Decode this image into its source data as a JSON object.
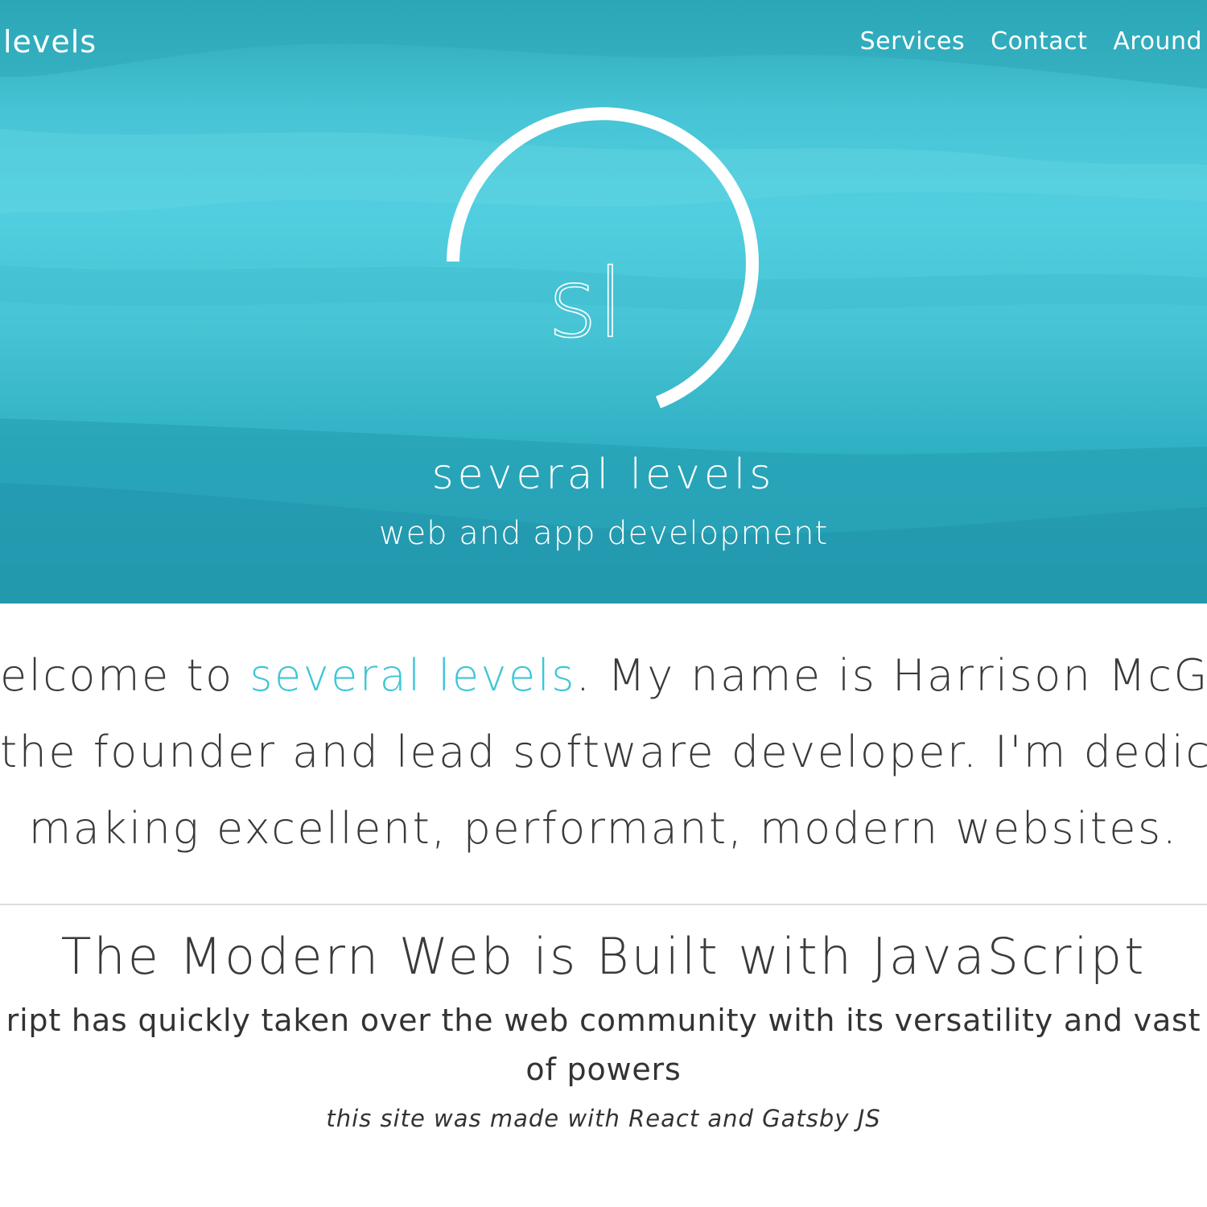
{
  "header": {
    "brand": "levels",
    "nav": [
      "Services",
      "Contact",
      "Around"
    ]
  },
  "hero": {
    "logo_text": "sl",
    "title": "several levels",
    "subtitle": "web and app development"
  },
  "intro": {
    "line1_prefix": "elcome to ",
    "line1_link": "several levels",
    "line1_suffix": ". My name is Harrison McGuire",
    "line2": "the founder and lead software developer. I'm dedicated",
    "line3": "making excellent, performant, modern websites."
  },
  "section": {
    "heading": "The Modern Web is Built with JavaScript",
    "body_line1": "ript has quickly taken over the web community with its versatility and vast",
    "body_line2": "of powers",
    "note": "this site was made with React and Gatsby JS"
  },
  "colors": {
    "hero_teal": "#51cfe0",
    "accent": "#3ec6d7",
    "text": "#333333"
  }
}
